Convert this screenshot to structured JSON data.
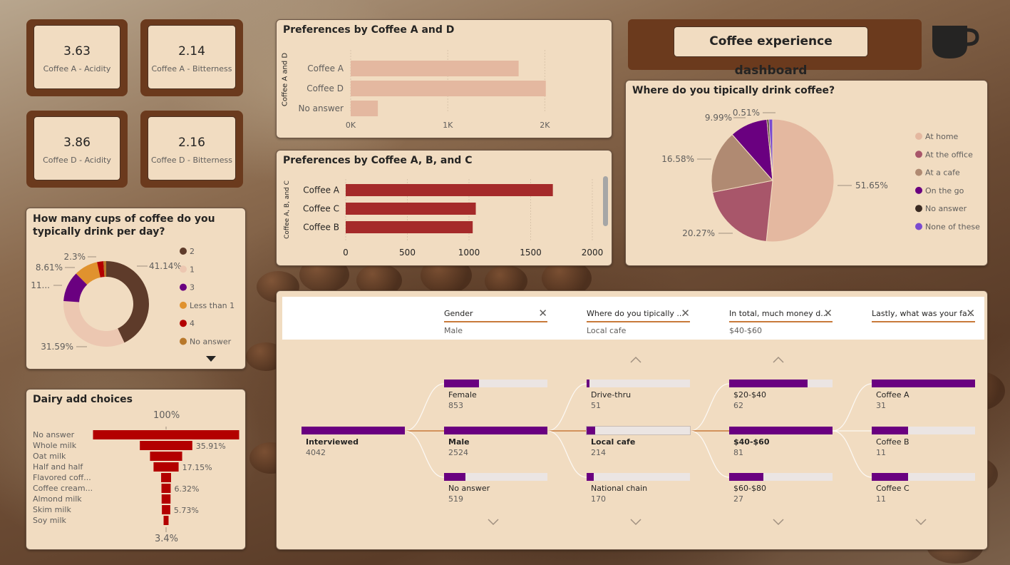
{
  "colors": {
    "panel": "#f1dcc1",
    "accent": "#6b3a1d",
    "bar_pink": "#e4b8a0",
    "bar_red": "#a52a2a",
    "purple": "#6a0080",
    "funnel_red": "#b30000"
  },
  "kpis": [
    {
      "value": "3.63",
      "label": "Coffee A - Acidity"
    },
    {
      "value": "2.14",
      "label": "Coffee A - Bitterness"
    },
    {
      "value": "3.86",
      "label": "Coffee D - Acidity"
    },
    {
      "value": "2.16",
      "label": "Coffee D - Bitterness"
    }
  ],
  "header": {
    "title": "Coffee experience dashboard",
    "icon": "coffee-cup-icon"
  },
  "pref_ad": {
    "title": "Preferences by Coffee A and D",
    "ylabel": "Coffee A and D",
    "ticks": [
      "0K",
      "1K",
      "2K"
    ]
  },
  "pref_abc": {
    "title": "Preferences by Coffee A, B, and C",
    "ylabel": "Coffee A, B, and C",
    "ticks": [
      "0",
      "500",
      "1000",
      "1500",
      "2000"
    ]
  },
  "where": {
    "title": "Where do you tipically drink coffee?"
  },
  "cups": {
    "title": "How many cups of coffee do you typically drink per day?",
    "more_icon": "chevron-down-icon"
  },
  "dairy": {
    "title": "Dairy add choices",
    "top_pct": "100%",
    "bottom_pct": "3.4%"
  },
  "chart_data": [
    {
      "type": "bar",
      "title": "Preferences by Coffee A and D",
      "categories": [
        "Coffee A",
        "Coffee D",
        "No answer"
      ],
      "values": [
        1730,
        2010,
        280
      ],
      "xlim": [
        0,
        2100
      ],
      "ylabel": "Coffee A and D"
    },
    {
      "type": "bar",
      "title": "Preferences by Coffee A, B, and C",
      "categories": [
        "Coffee A",
        "Coffee C",
        "Coffee B"
      ],
      "values": [
        1680,
        1055,
        1030
      ],
      "xlim": [
        0,
        2000
      ],
      "ylabel": "Coffee A, B, and C"
    },
    {
      "type": "pie",
      "title": "Where do you tipically drink coffee?",
      "categories": [
        "At home",
        "At the office",
        "At a cafe",
        "On the go",
        "No answer",
        "None of these"
      ],
      "values": [
        51.65,
        20.27,
        16.58,
        9.99,
        0.51,
        1.0
      ],
      "labels": [
        "51.65%",
        "20.27%",
        "16.58%",
        "9.99%",
        "0.51%",
        ""
      ],
      "colors": [
        "#e4b8a0",
        "#a8566a",
        "#b08a72",
        "#6a0080",
        "#3a2a22",
        "#7a4ad0"
      ],
      "legend": "right"
    },
    {
      "type": "pie",
      "title": "How many cups of coffee do you typically drink per day?",
      "categories": [
        "2",
        "1",
        "3",
        "Less than 1",
        "4",
        "No answer"
      ],
      "values": [
        41.14,
        31.59,
        11.0,
        8.61,
        2.3,
        1.0
      ],
      "labels": [
        "41.14%",
        "31.59%",
        "11...",
        "8.61%",
        "2.3%",
        ""
      ],
      "colors": [
        "#5e3b2a",
        "#ecc7b1",
        "#6a0080",
        "#e0922e",
        "#b30000",
        "#b8782a"
      ],
      "legend": "right"
    },
    {
      "type": "bar",
      "title": "Dairy add choices",
      "categories": [
        "No answer",
        "Whole milk",
        "Oat milk",
        "Half and half",
        "Flavored coff...",
        "Coffee cream...",
        "Almond milk",
        "Skim milk",
        "Soy milk"
      ],
      "values": [
        100,
        35.91,
        22,
        17.15,
        6.8,
        6.32,
        6.1,
        5.73,
        3.4
      ],
      "labels": [
        "",
        "35.91%",
        "",
        "17.15%",
        "",
        "6.32%",
        "",
        "5.73%",
        ""
      ]
    }
  ],
  "tree": {
    "filters": [
      {
        "name": "Gender",
        "value": "Male"
      },
      {
        "name": "Where do you tipically ...",
        "value": "Local cafe"
      },
      {
        "name": "In total, much money d...",
        "value": "$40-$60"
      },
      {
        "name": "Lastly, what was your fa...",
        "value": ""
      }
    ],
    "root": {
      "name": "Interviewed",
      "value": "4042",
      "frac": 1.0
    },
    "levels": [
      [
        {
          "name": "Female",
          "value": "853",
          "frac": 0.34
        },
        {
          "name": "Male",
          "value": "2524",
          "frac": 1.0,
          "selected": true
        },
        {
          "name": "No answer",
          "value": "519",
          "frac": 0.21
        }
      ],
      [
        {
          "name": "Drive-thru",
          "value": "51",
          "frac": 0.03
        },
        {
          "name": "Local cafe",
          "value": "214",
          "frac": 0.08,
          "selected": true
        },
        {
          "name": "National chain",
          "value": "170",
          "frac": 0.07
        }
      ],
      [
        {
          "name": "$20-$40",
          "value": "62",
          "frac": 0.76
        },
        {
          "name": "$40-$60",
          "value": "81",
          "frac": 1.0,
          "selected": true
        },
        {
          "name": "$60-$80",
          "value": "27",
          "frac": 0.33
        }
      ],
      [
        {
          "name": "Coffee A",
          "value": "31",
          "frac": 1.0
        },
        {
          "name": "Coffee B",
          "value": "11",
          "frac": 0.35
        },
        {
          "name": "Coffee C",
          "value": "11",
          "frac": 0.35
        }
      ]
    ]
  }
}
